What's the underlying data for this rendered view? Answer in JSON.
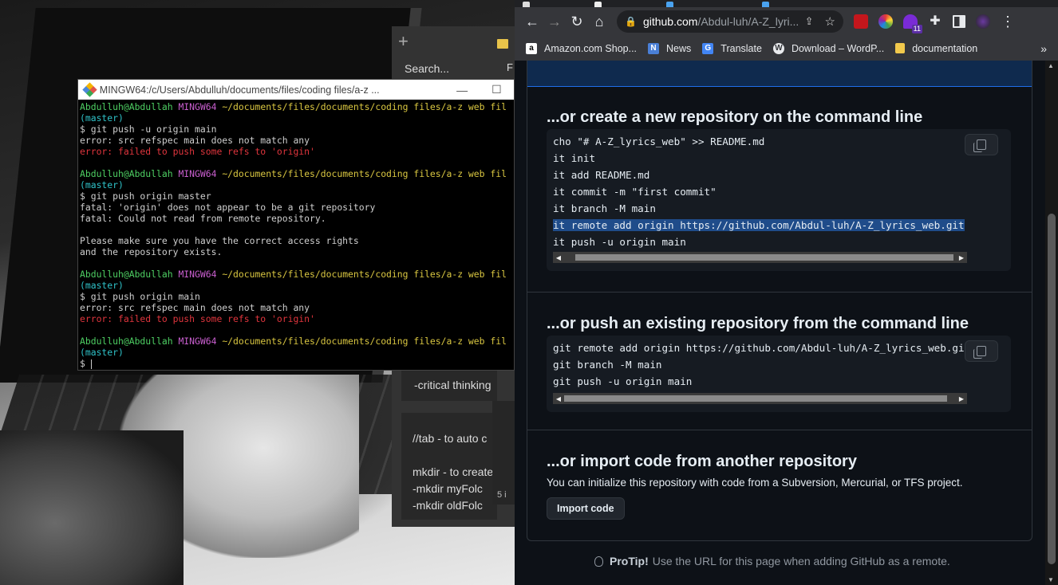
{
  "notes_app": {
    "search_placeholder": "Search...",
    "f_label": "F",
    "note1": "-critical thinking",
    "note2_lines": [
      "//tab - to auto c",
      "",
      "mkdir - to create",
      "   -mkdir myFolc",
      "   -mkdir oldFolc"
    ],
    "side_num": "5 i"
  },
  "terminal": {
    "title": "MINGW64:/c/Users/Abdulluh/documents/files/coding files/a-z ...",
    "prompt_user": "Abdulluh@Abdullah",
    "prompt_shell": "MINGW64",
    "prompt_path": "~/documents/files/documents/coding files/a-z web fil",
    "prompt_branch": "(master)",
    "cmd1": "$ git push -u origin main",
    "out1": "error: src refspec main does not match any",
    "err1": "error: failed to push some refs to 'origin'",
    "cmd2": "$ git push origin master",
    "out2a": "fatal: 'origin' does not appear to be a git repository",
    "out2b": "fatal: Could not read from remote repository.",
    "out2c": "Please make sure you have the correct access rights",
    "out2d": "and the repository exists.",
    "cmd3": "$ git push origin main",
    "out3": "error: src refspec main does not match any",
    "err3": "error: failed to push some refs to 'origin'",
    "cmd4": "$ "
  },
  "browser": {
    "url_host": "github.com",
    "url_path": "/Abdul-luh/A-Z_lyri...",
    "ext_badge": "11",
    "bookmarks": [
      {
        "label": "Amazon.com Shop...",
        "icon": "amazon-icon"
      },
      {
        "label": "News",
        "icon": "news-icon"
      },
      {
        "label": "Translate",
        "icon": "translate-icon"
      },
      {
        "label": "Download – WordP...",
        "icon": "wordpress-icon"
      },
      {
        "label": "documentation",
        "icon": "folder-icon"
      }
    ],
    "more": "»"
  },
  "github": {
    "new_repo_heading": "...or create a new repository on the command line",
    "new_repo_code": [
      "cho \"# A-Z_lyrics_web\" >> README.md",
      "it init",
      "it add README.md",
      "it commit -m \"first commit\"",
      "it branch -M main",
      "it remote add origin https://github.com/Abdul-luh/A-Z_lyrics_web.git",
      "it push -u origin main"
    ],
    "push_heading": "...or push an existing repository from the command line",
    "push_code": [
      "git remote add origin https://github.com/Abdul-luh/A-Z_lyrics_web.gi",
      "git branch -M main",
      "git push -u origin main"
    ],
    "import_heading": "...or import code from another repository",
    "import_desc": "You can initialize this repository with code from a Subversion, Mercurial, or TFS project.",
    "import_button": "Import code",
    "protip_label": "ProTip!",
    "protip_text": "Use the URL for this page when adding GitHub as a remote."
  }
}
